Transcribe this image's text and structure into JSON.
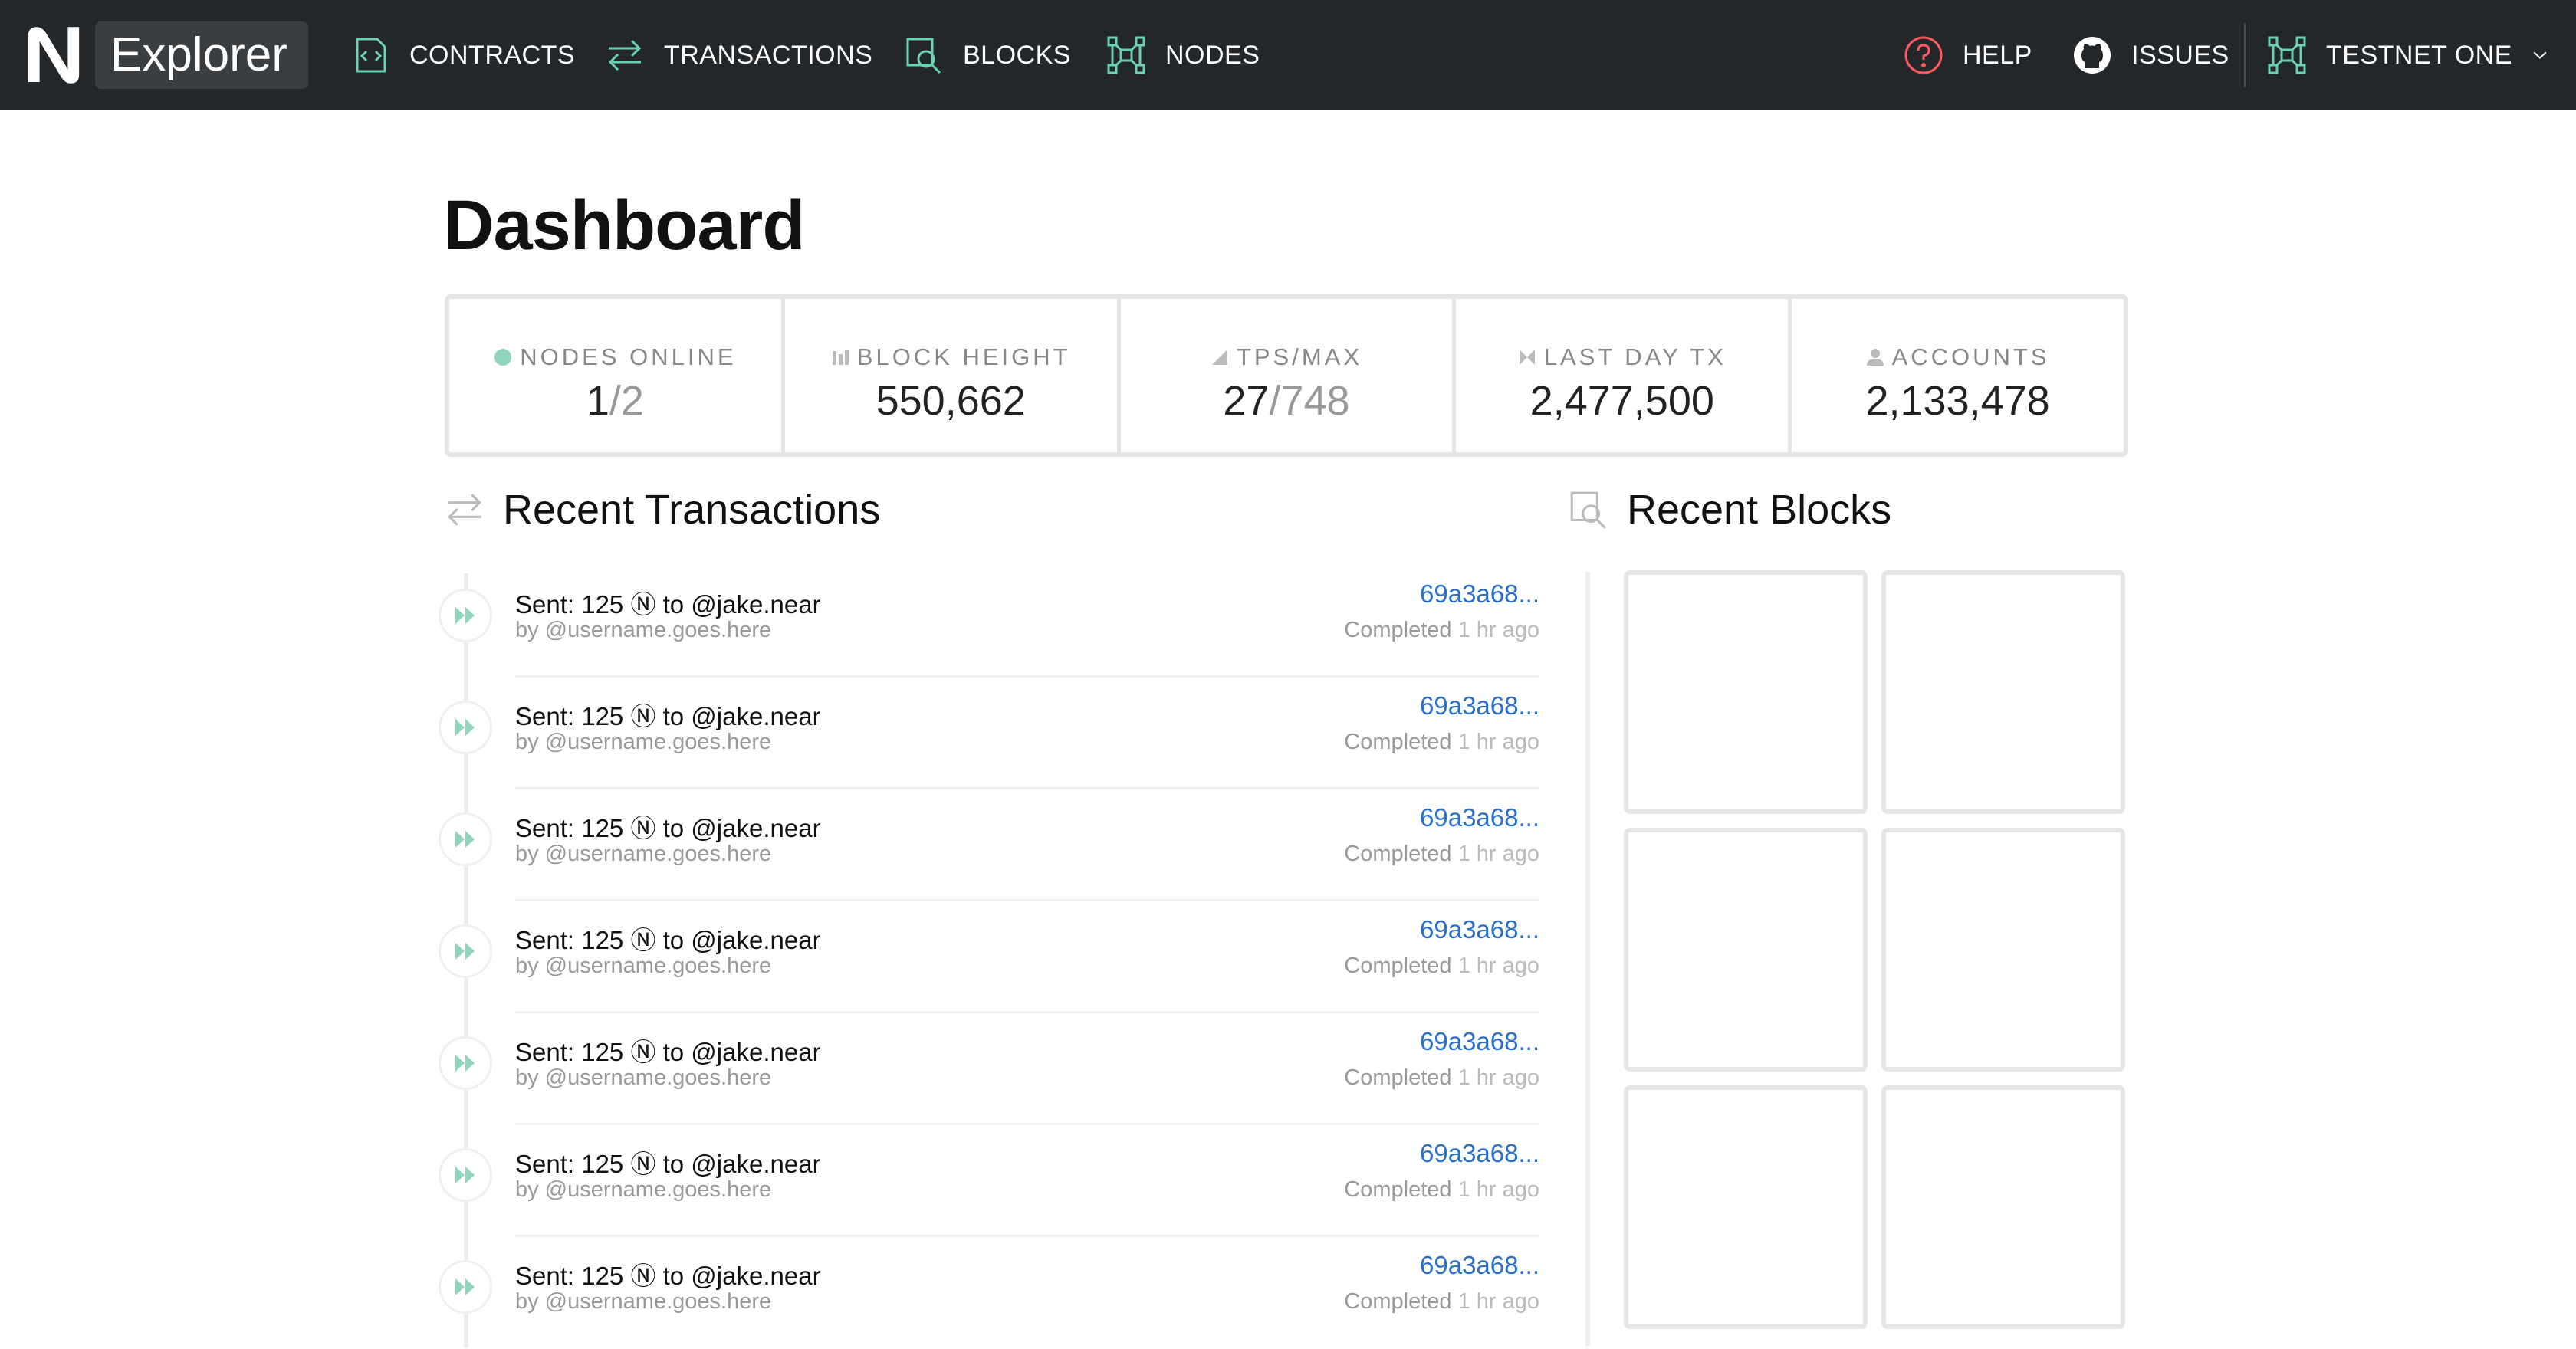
{
  "brand": {
    "name": "Explorer"
  },
  "nav": {
    "items": [
      {
        "label": "CONTRACTS",
        "icon": "code-bracket-icon"
      },
      {
        "label": "TRANSACTIONS",
        "icon": "arrows-exchange-icon"
      },
      {
        "label": "BLOCKS",
        "icon": "block-search-icon"
      },
      {
        "label": "NODES",
        "icon": "nodes-network-icon"
      }
    ],
    "right": [
      {
        "label": "HELP",
        "icon": "help-circle-icon"
      },
      {
        "label": "ISSUES",
        "icon": "github-icon"
      }
    ],
    "network": {
      "label": "TESTNET ONE",
      "icon": "nodes-network-icon"
    }
  },
  "colors": {
    "topbar": "#24272a",
    "accent": "#6ad1b4",
    "link": "#2a6fc9",
    "help": "#ff585d"
  },
  "page": {
    "title": "Dashboard"
  },
  "stats": [
    {
      "label": "NODES ONLINE",
      "value": "1",
      "suffix": "/2",
      "icon": "status-dot-icon"
    },
    {
      "label": "BLOCK HEIGHT",
      "value": "550,662",
      "icon": "bar-chart-icon"
    },
    {
      "label": "TPS/MAX",
      "value": "27",
      "suffix": "/748",
      "icon": "signal-icon"
    },
    {
      "label": "LAST DAY TX",
      "value": "2,477,500",
      "icon": "bowtie-icon"
    },
    {
      "label": "ACCOUNTS",
      "value": "2,133,478",
      "icon": "user-icon"
    }
  ],
  "transactions": {
    "heading": "Recent Transactions",
    "items": [
      {
        "title": "Sent: 125 Ⓝ to @jake.near",
        "by": "by @username.goes.here",
        "hash": "69a3a68...",
        "status": "Completed",
        "time": "1 hr ago"
      },
      {
        "title": "Sent: 125 Ⓝ to @jake.near",
        "by": "by @username.goes.here",
        "hash": "69a3a68...",
        "status": "Completed",
        "time": "1 hr ago"
      },
      {
        "title": "Sent: 125 Ⓝ to @jake.near",
        "by": "by @username.goes.here",
        "hash": "69a3a68...",
        "status": "Completed",
        "time": "1 hr ago"
      },
      {
        "title": "Sent: 125 Ⓝ to @jake.near",
        "by": "by @username.goes.here",
        "hash": "69a3a68...",
        "status": "Completed",
        "time": "1 hr ago"
      },
      {
        "title": "Sent: 125 Ⓝ to @jake.near",
        "by": "by @username.goes.here",
        "hash": "69a3a68...",
        "status": "Completed",
        "time": "1 hr ago"
      },
      {
        "title": "Sent: 125 Ⓝ to @jake.near",
        "by": "by @username.goes.here",
        "hash": "69a3a68...",
        "status": "Completed",
        "time": "1 hr ago"
      },
      {
        "title": "Sent: 125 Ⓝ to @jake.near",
        "by": "by @username.goes.here",
        "hash": "69a3a68...",
        "status": "Completed",
        "time": "1 hr ago"
      }
    ]
  },
  "blocks": {
    "heading": "Recent Blocks",
    "tile_count": 6
  }
}
